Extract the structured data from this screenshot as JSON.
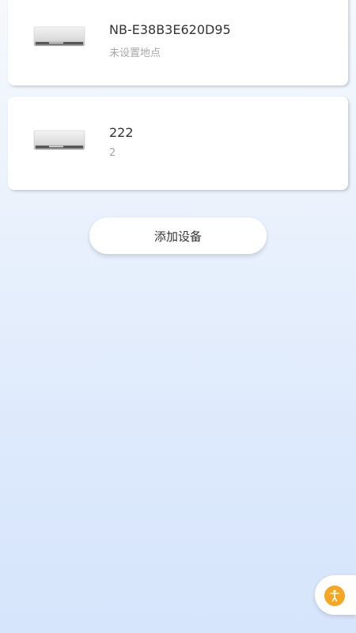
{
  "devices": [
    {
      "name": "NB-E38B3E620D95",
      "location": "未设置地点",
      "icon": "air-conditioner-icon"
    },
    {
      "name": "222",
      "location": "2",
      "icon": "air-conditioner-icon"
    }
  ],
  "add_button": {
    "label": "添加设备"
  },
  "accessibility_fab": {
    "icon": "accessibility-icon",
    "accent_color": "#f5a623"
  }
}
